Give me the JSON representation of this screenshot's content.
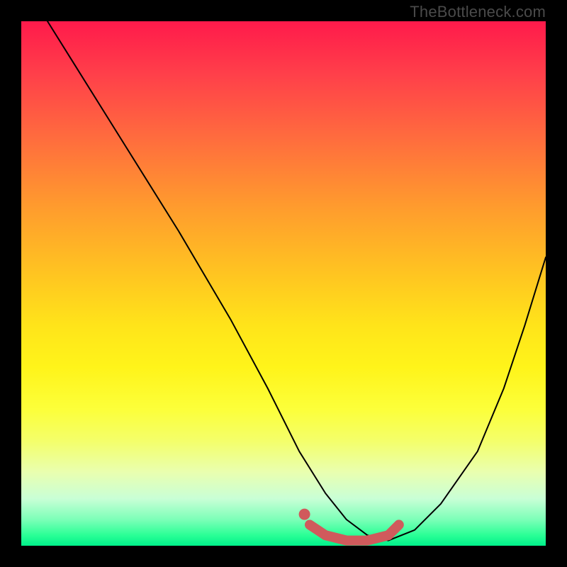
{
  "watermark": "TheBottleneck.com",
  "chart_data": {
    "type": "line",
    "title": "",
    "xlabel": "",
    "ylabel": "",
    "xlim": [
      0,
      100
    ],
    "ylim": [
      0,
      100
    ],
    "series": [
      {
        "name": "curve",
        "x": [
          5,
          10,
          20,
          30,
          40,
          47,
          53,
          58,
          62,
          66,
          70,
          75,
          80,
          87,
          92,
          96,
          100
        ],
        "values": [
          100,
          92,
          76,
          60,
          43,
          30,
          18,
          10,
          5,
          2,
          1,
          3,
          8,
          18,
          30,
          42,
          55
        ]
      }
    ],
    "highlight_segment": {
      "name": "optimal-range",
      "x": [
        55,
        58,
        62,
        66,
        70,
        72
      ],
      "values": [
        4,
        2,
        1,
        1,
        2,
        4
      ]
    },
    "highlight_point": {
      "x": 54,
      "y": 6
    },
    "colors": {
      "curve": "#000000",
      "highlight": "#d05a5c",
      "gradient_top": "#ff1a4b",
      "gradient_mid": "#ffe41a",
      "gradient_bottom": "#00f08a"
    }
  }
}
